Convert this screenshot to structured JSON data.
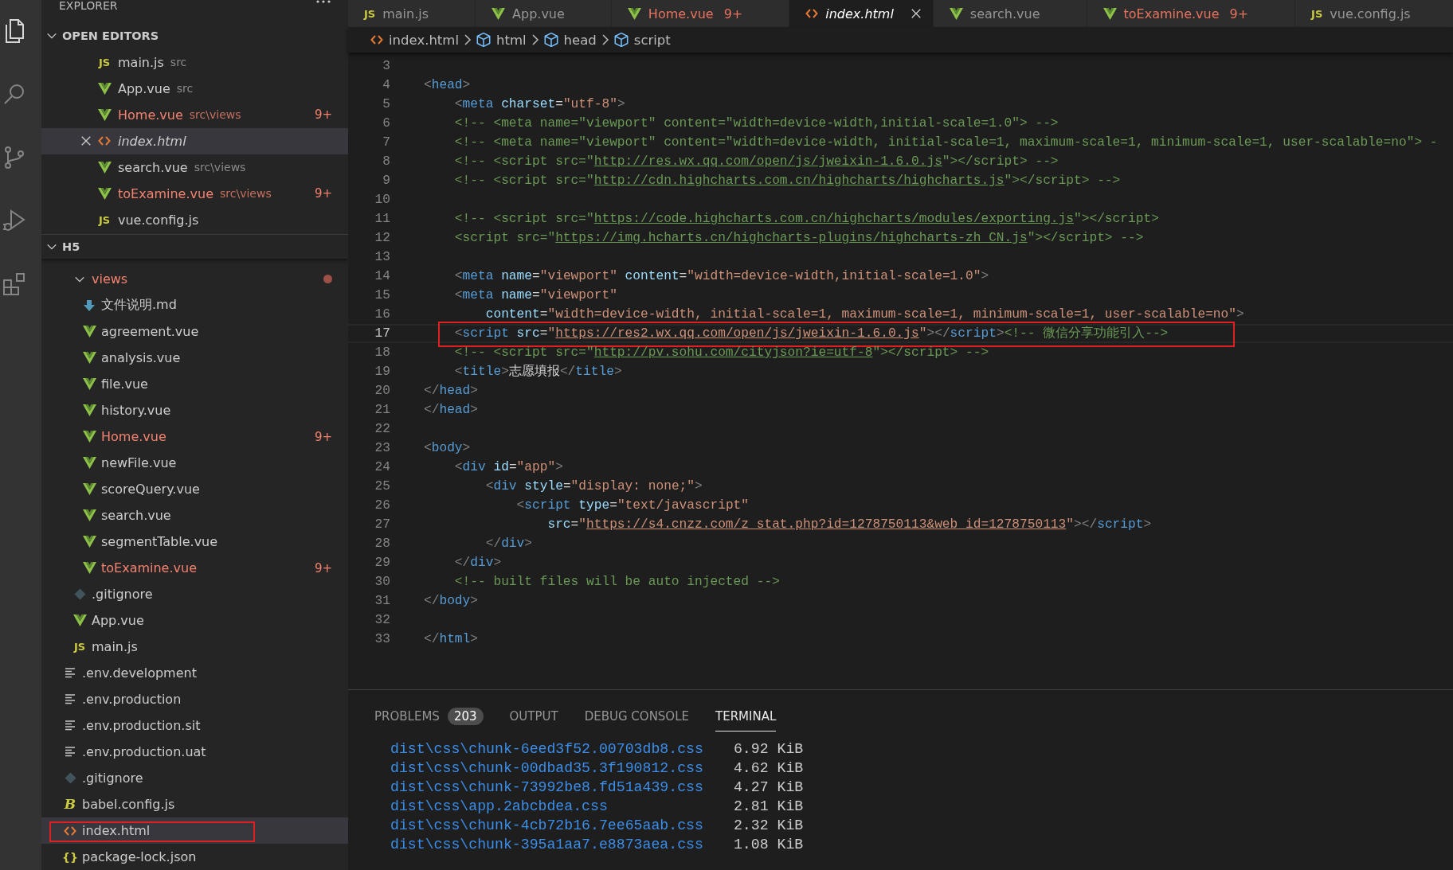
{
  "activity_bar": [
    {
      "kind": "files",
      "selected": true
    },
    {
      "kind": "search",
      "selected": false
    },
    {
      "kind": "source-control",
      "selected": false
    },
    {
      "kind": "run-debug",
      "selected": false
    },
    {
      "kind": "extensions",
      "selected": false
    }
  ],
  "sidebar": {
    "title": "EXPLORER",
    "sections": [
      {
        "title": "OPEN EDITORS",
        "kind": "open-editors",
        "expanded": true,
        "items": [
          {
            "name": "main.js",
            "kind": "js",
            "icon_label": "JS",
            "detail": "src",
            "error": false,
            "preview": false,
            "selected": false,
            "annotated": false
          },
          {
            "name": "App.vue",
            "kind": "vue",
            "detail": "src",
            "error": false,
            "preview": false,
            "selected": false,
            "annotated": false
          },
          {
            "name": "Home.vue",
            "kind": "vue",
            "detail": "src\\views",
            "badge": "9+",
            "error": true,
            "preview": false,
            "selected": false,
            "annotated": false
          },
          {
            "name": "index.html",
            "kind": "html",
            "error": false,
            "preview": true,
            "selected": true,
            "annotated": false
          },
          {
            "name": "search.vue",
            "kind": "vue",
            "detail": "src\\views",
            "error": false,
            "preview": false,
            "selected": false,
            "annotated": false
          },
          {
            "name": "toExamine.vue",
            "kind": "vue",
            "detail": "src\\views",
            "badge": "9+",
            "error": true,
            "preview": false,
            "selected": false,
            "annotated": false
          },
          {
            "name": "vue.config.js",
            "kind": "js",
            "icon_label": "JS",
            "error": false,
            "preview": false,
            "selected": false,
            "annotated": false
          }
        ]
      },
      {
        "title": "H5",
        "kind": "tree",
        "expanded": true,
        "items": [
          {
            "children": [
              {
                "name": "views",
                "kind": "folder",
                "expanded": true,
                "has_problems": true,
                "error": true,
                "selected": false,
                "annotated": false,
                "children": [
                  {
                    "name": "文件说明.md",
                    "kind": "md",
                    "error": false,
                    "selected": false,
                    "annotated": false
                  },
                  {
                    "name": "agreement.vue",
                    "kind": "vue",
                    "error": false,
                    "selected": false,
                    "annotated": false
                  },
                  {
                    "name": "analysis.vue",
                    "kind": "vue",
                    "error": false,
                    "selected": false,
                    "annotated": false
                  },
                  {
                    "name": "file.vue",
                    "kind": "vue",
                    "error": false,
                    "selected": false,
                    "annotated": false
                  },
                  {
                    "name": "history.vue",
                    "kind": "vue",
                    "error": false,
                    "selected": false,
                    "annotated": false
                  },
                  {
                    "name": "Home.vue",
                    "kind": "vue",
                    "badge": "9+",
                    "error": true,
                    "selected": false,
                    "annotated": false
                  },
                  {
                    "name": "newFile.vue",
                    "kind": "vue",
                    "error": false,
                    "selected": false,
                    "annotated": false
                  },
                  {
                    "name": "scoreQuery.vue",
                    "kind": "vue",
                    "error": false,
                    "selected": false,
                    "annotated": false
                  },
                  {
                    "name": "search.vue",
                    "kind": "vue",
                    "error": false,
                    "selected": false,
                    "annotated": false
                  },
                  {
                    "name": "segmentTable.vue",
                    "kind": "vue",
                    "error": false,
                    "selected": false,
                    "annotated": false
                  },
                  {
                    "name": "toExamine.vue",
                    "kind": "vue",
                    "badge": "9+",
                    "error": true,
                    "selected": false,
                    "annotated": false
                  }
                ]
              },
              {
                "name": ".gitignore",
                "kind": "git",
                "error": false,
                "selected": false,
                "annotated": false
              },
              {
                "name": "App.vue",
                "kind": "vue",
                "error": false,
                "selected": false,
                "annotated": false
              },
              {
                "name": "main.js",
                "kind": "js",
                "icon_label": "JS",
                "error": false,
                "selected": false,
                "annotated": false
              }
            ]
          },
          {
            "name": ".env.development",
            "kind": "env",
            "error": false,
            "selected": false,
            "annotated": false
          },
          {
            "name": ".env.production",
            "kind": "env",
            "error": false,
            "selected": false,
            "annotated": false
          },
          {
            "name": ".env.production.sit",
            "kind": "env",
            "error": false,
            "selected": false,
            "annotated": false
          },
          {
            "name": ".env.production.uat",
            "kind": "env",
            "error": false,
            "selected": false,
            "annotated": false
          },
          {
            "name": ".gitignore",
            "kind": "git",
            "error": false,
            "selected": false,
            "annotated": false
          },
          {
            "name": "babel.config.js",
            "kind": "babel",
            "icon_label": "B",
            "error": false,
            "selected": false,
            "annotated": false
          },
          {
            "name": "index.html",
            "kind": "html",
            "error": false,
            "selected": true,
            "annotated": true
          },
          {
            "name": "package-lock.json",
            "kind": "json",
            "icon_label": "{}",
            "error": false,
            "selected": false,
            "annotated": false
          }
        ]
      }
    ]
  },
  "editor": {
    "tabs": [
      {
        "label": "main.js",
        "kind": "js",
        "icon_label": "JS",
        "error": false,
        "preview": false,
        "selected": false
      },
      {
        "label": "App.vue",
        "kind": "vue",
        "error": false,
        "preview": false,
        "selected": false
      },
      {
        "label": "Home.vue",
        "kind": "vue",
        "badge": "9+",
        "error": true,
        "preview": false,
        "selected": false
      },
      {
        "label": "index.html",
        "kind": "html",
        "error": false,
        "preview": true,
        "selected": true
      },
      {
        "label": "search.vue",
        "kind": "vue",
        "error": false,
        "preview": false,
        "selected": false
      },
      {
        "label": "toExamine.vue",
        "kind": "vue",
        "badge": "9+",
        "error": true,
        "preview": false,
        "selected": false
      },
      {
        "label": "vue.config.js",
        "kind": "js",
        "icon_label": "JS",
        "error": false,
        "preview": false,
        "selected": false
      }
    ],
    "breadcrumb": [
      {
        "kind": "html",
        "label": "index.html"
      },
      {
        "kind": "element",
        "label": "html"
      },
      {
        "kind": "element",
        "label": "head"
      },
      {
        "kind": "element",
        "label": "script"
      }
    ],
    "lines": [
      {
        "number": "3",
        "current": false,
        "annotated": false
      },
      {
        "number": "4",
        "current": false,
        "annotated": false,
        "tokens": [
          {
            "kind": "punct",
            "text": "<"
          },
          {
            "kind": "tag",
            "text": "head"
          },
          {
            "kind": "punct",
            "text": ">"
          }
        ]
      },
      {
        "number": "5",
        "current": false,
        "annotated": false,
        "tokens": [
          {
            "kind": "punct",
            "text": "    <"
          },
          {
            "kind": "tag",
            "text": "meta"
          },
          {
            "kind": "attr",
            "text": " charset"
          },
          {
            "kind": "plain",
            "text": "="
          },
          {
            "kind": "string",
            "text": "\"utf-8\""
          },
          {
            "kind": "punct",
            "text": ">"
          }
        ]
      },
      {
        "number": "6",
        "current": false,
        "annotated": false,
        "tokens": [
          {
            "kind": "comment",
            "text": "    <!-- <meta name=\"viewport\" content=\"width=device-width,initial-scale=1.0\"> -->"
          }
        ]
      },
      {
        "number": "7",
        "current": false,
        "annotated": false,
        "tokens": [
          {
            "kind": "comment",
            "text": "    <!-- <meta name=\"viewport\" content=\"width=device-width, initial-scale=1, maximum-scale=1, minimum-scale=1, user-scalable=no\"> -"
          }
        ]
      },
      {
        "number": "8",
        "current": false,
        "annotated": false,
        "tokens": [
          {
            "kind": "comment",
            "text": "    <!-- <script src=\""
          },
          {
            "kind": "comment-link",
            "text": "http://res.wx.qq.com/open/js/jweixin-1.6.0.js"
          },
          {
            "kind": "comment",
            "text": "\"></script> -->"
          }
        ]
      },
      {
        "number": "9",
        "current": false,
        "annotated": false,
        "tokens": [
          {
            "kind": "comment",
            "text": "    <!-- <script src=\""
          },
          {
            "kind": "comment-link",
            "text": "http://cdn.highcharts.com.cn/highcharts/highcharts.js"
          },
          {
            "kind": "comment",
            "text": "\"></script> -->"
          }
        ]
      },
      {
        "number": "10",
        "current": false,
        "annotated": false
      },
      {
        "number": "11",
        "current": false,
        "annotated": false,
        "tokens": [
          {
            "kind": "comment",
            "text": "    <!-- <script src=\""
          },
          {
            "kind": "comment-link",
            "text": "https://code.highcharts.com.cn/highcharts/modules/exporting.js"
          },
          {
            "kind": "comment",
            "text": "\"></script>"
          }
        ]
      },
      {
        "number": "12",
        "current": false,
        "annotated": false,
        "tokens": [
          {
            "kind": "comment",
            "text": "    <script src=\""
          },
          {
            "kind": "comment-link",
            "text": "https://img.hcharts.cn/highcharts-plugins/highcharts-zh_CN.js"
          },
          {
            "kind": "comment",
            "text": "\"></script> -->"
          }
        ]
      },
      {
        "number": "13",
        "current": false,
        "annotated": false
      },
      {
        "number": "14",
        "current": false,
        "annotated": false,
        "tokens": [
          {
            "kind": "punct",
            "text": "    <"
          },
          {
            "kind": "tag",
            "text": "meta"
          },
          {
            "kind": "attr",
            "text": " name"
          },
          {
            "kind": "plain",
            "text": "="
          },
          {
            "kind": "string",
            "text": "\"viewport\""
          },
          {
            "kind": "attr",
            "text": " content"
          },
          {
            "kind": "plain",
            "text": "="
          },
          {
            "kind": "string",
            "text": "\"width=device-width,initial-scale=1.0\""
          },
          {
            "kind": "punct",
            "text": ">"
          }
        ]
      },
      {
        "number": "15",
        "current": false,
        "annotated": false,
        "tokens": [
          {
            "kind": "punct",
            "text": "    <"
          },
          {
            "kind": "tag",
            "text": "meta"
          },
          {
            "kind": "attr",
            "text": " name"
          },
          {
            "kind": "plain",
            "text": "="
          },
          {
            "kind": "string",
            "text": "\"viewport\""
          }
        ]
      },
      {
        "number": "16",
        "current": false,
        "annotated": false,
        "tokens": [
          {
            "kind": "attr",
            "text": "        content"
          },
          {
            "kind": "plain",
            "text": "="
          },
          {
            "kind": "string",
            "text": "\"width=device-width, initial-scale=1, maximum-scale=1, minimum-scale=1, user-scalable=no\""
          },
          {
            "kind": "punct",
            "text": ">"
          }
        ]
      },
      {
        "number": "17",
        "current": true,
        "annotated": true,
        "tokens": [
          {
            "kind": "punct",
            "text": "    <"
          },
          {
            "kind": "tag",
            "text": "script"
          },
          {
            "kind": "attr",
            "text": " src"
          },
          {
            "kind": "plain",
            "text": "="
          },
          {
            "kind": "string",
            "text": "\""
          },
          {
            "kind": "string-link",
            "text": "https://res2.wx.qq.com/open/js/jweixin-1.6.0.js"
          },
          {
            "kind": "string",
            "text": "\""
          },
          {
            "kind": "punct",
            "text": "></"
          },
          {
            "kind": "tag",
            "text": "script"
          },
          {
            "kind": "punct",
            "text": ">"
          },
          {
            "kind": "comment",
            "text": "<!-- 微信分享功能引入-->"
          }
        ]
      },
      {
        "number": "18",
        "current": false,
        "annotated": false,
        "tokens": [
          {
            "kind": "comment",
            "text": "    <!-- <script src=\""
          },
          {
            "kind": "comment-link",
            "text": "http://pv.sohu.com/cityjson?ie=utf-8"
          },
          {
            "kind": "comment",
            "text": "\"></script> -->"
          }
        ]
      },
      {
        "number": "19",
        "current": false,
        "annotated": false,
        "tokens": [
          {
            "kind": "punct",
            "text": "    <"
          },
          {
            "kind": "tag",
            "text": "title"
          },
          {
            "kind": "punct",
            "text": ">"
          },
          {
            "kind": "plain",
            "text": "志愿填报"
          },
          {
            "kind": "punct",
            "text": "</"
          },
          {
            "kind": "tag",
            "text": "title"
          },
          {
            "kind": "punct",
            "text": ">"
          }
        ]
      },
      {
        "number": "20",
        "current": false,
        "annotated": false,
        "tokens": [
          {
            "kind": "punct",
            "text": "</"
          },
          {
            "kind": "tag",
            "text": "head"
          },
          {
            "kind": "punct",
            "text": ">"
          }
        ]
      },
      {
        "number": "21",
        "current": false,
        "annotated": false,
        "tokens": [
          {
            "kind": "punct",
            "text": "</"
          },
          {
            "kind": "tag",
            "text": "head"
          },
          {
            "kind": "punct",
            "text": ">"
          }
        ]
      },
      {
        "number": "22",
        "current": false,
        "annotated": false
      },
      {
        "number": "23",
        "current": false,
        "annotated": false,
        "tokens": [
          {
            "kind": "punct",
            "text": "<"
          },
          {
            "kind": "tag",
            "text": "body"
          },
          {
            "kind": "punct",
            "text": ">"
          }
        ]
      },
      {
        "number": "24",
        "current": false,
        "annotated": false,
        "tokens": [
          {
            "kind": "punct",
            "text": "    <"
          },
          {
            "kind": "tag",
            "text": "div"
          },
          {
            "kind": "attr",
            "text": " id"
          },
          {
            "kind": "plain",
            "text": "="
          },
          {
            "kind": "string",
            "text": "\"app\""
          },
          {
            "kind": "punct",
            "text": ">"
          }
        ]
      },
      {
        "number": "25",
        "current": false,
        "annotated": false,
        "tokens": [
          {
            "kind": "punct",
            "text": "        <"
          },
          {
            "kind": "tag",
            "text": "div"
          },
          {
            "kind": "attr",
            "text": " style"
          },
          {
            "kind": "plain",
            "text": "="
          },
          {
            "kind": "string",
            "text": "\"display: none;\""
          },
          {
            "kind": "punct",
            "text": ">"
          }
        ]
      },
      {
        "number": "26",
        "current": false,
        "annotated": false,
        "tokens": [
          {
            "kind": "punct",
            "text": "            <"
          },
          {
            "kind": "tag",
            "text": "script"
          },
          {
            "kind": "attr",
            "text": " type"
          },
          {
            "kind": "plain",
            "text": "="
          },
          {
            "kind": "string",
            "text": "\"text/javascript\""
          }
        ]
      },
      {
        "number": "27",
        "current": false,
        "annotated": false,
        "tokens": [
          {
            "kind": "attr",
            "text": "                src"
          },
          {
            "kind": "plain",
            "text": "="
          },
          {
            "kind": "string",
            "text": "\""
          },
          {
            "kind": "string-link",
            "text": "https://s4.cnzz.com/z_stat.php?id=1278750113&web_id=1278750113"
          },
          {
            "kind": "string",
            "text": "\""
          },
          {
            "kind": "punct",
            "text": "></"
          },
          {
            "kind": "tag",
            "text": "script"
          },
          {
            "kind": "punct",
            "text": ">"
          }
        ]
      },
      {
        "number": "28",
        "current": false,
        "annotated": false,
        "tokens": [
          {
            "kind": "punct",
            "text": "        </"
          },
          {
            "kind": "tag",
            "text": "div"
          },
          {
            "kind": "punct",
            "text": ">"
          }
        ]
      },
      {
        "number": "29",
        "current": false,
        "annotated": false,
        "tokens": [
          {
            "kind": "punct",
            "text": "    </"
          },
          {
            "kind": "tag",
            "text": "div"
          },
          {
            "kind": "punct",
            "text": ">"
          }
        ]
      },
      {
        "number": "30",
        "current": false,
        "annotated": false,
        "tokens": [
          {
            "kind": "comment",
            "text": "    <!-- built files will be auto injected -->"
          }
        ]
      },
      {
        "number": "31",
        "current": false,
        "annotated": false,
        "tokens": [
          {
            "kind": "punct",
            "text": "</"
          },
          {
            "kind": "tag",
            "text": "body"
          },
          {
            "kind": "punct",
            "text": ">"
          }
        ]
      },
      {
        "number": "32",
        "current": false,
        "annotated": false
      },
      {
        "number": "33",
        "current": false,
        "annotated": false,
        "tokens": [
          {
            "kind": "punct",
            "text": "</"
          },
          {
            "kind": "tag",
            "text": "html"
          },
          {
            "kind": "punct",
            "text": ">"
          }
        ]
      }
    ]
  },
  "panel": {
    "tabs": [
      {
        "label": "PROBLEMS",
        "count": "203",
        "selected": false
      },
      {
        "label": "OUTPUT",
        "selected": false
      },
      {
        "label": "DEBUG CONSOLE",
        "selected": false
      },
      {
        "label": "TERMINAL",
        "selected": true
      }
    ],
    "terminal": [
      {
        "path": "dist\\css\\chunk-6eed3f52.00703db8.css",
        "size": "6.92 KiB"
      },
      {
        "path": "dist\\css\\chunk-00dbad35.3f190812.css",
        "size": "4.62 KiB"
      },
      {
        "path": "dist\\css\\chunk-73992be8.fd51a439.css",
        "size": "4.27 KiB"
      },
      {
        "path": "dist\\css\\app.2abcbdea.css",
        "size": "2.81 KiB"
      },
      {
        "path": "dist\\css\\chunk-4cb72b16.7ee65aab.css",
        "size": "2.32 KiB"
      },
      {
        "path": "dist\\css\\chunk-395a1aa7.e8873aea.css",
        "size": "1.08 KiB"
      }
    ]
  }
}
